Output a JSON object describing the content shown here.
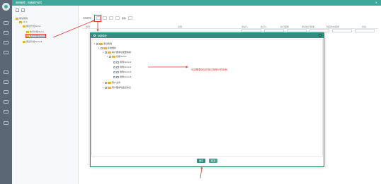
{
  "title": "用例管理 - 机器维护组件",
  "modal": {
    "title": "功能模块",
    "tree": [
      {
        "label": "测试用例",
        "level": 0
      },
      {
        "label": "系统维护",
        "level": 1
      },
      {
        "label": "客户要素功能要素库",
        "level": 2
      },
      {
        "label": "功能demo",
        "level": 3
      },
      {
        "label": "用例demo1",
        "level": 4
      },
      {
        "label": "用例demo2",
        "level": 4
      },
      {
        "label": "用例demo3",
        "level": 4
      },
      {
        "label": "用例demo4",
        "level": 4
      },
      {
        "label": "账户业务",
        "level": 2
      },
      {
        "label": "客户要求功能点信息",
        "level": 2
      }
    ],
    "annotation": "勾选需要添加的测试用例中的用例",
    "ok_label": "确定",
    "cancel_label": "取消"
  },
  "left_tree": [
    {
      "label": "测试用例"
    },
    {
      "label": "v1.0"
    },
    {
      "label": "测试计划demo"
    },
    {
      "label": "执行计划demo"
    },
    {
      "label": "执行计划demo2"
    },
    {
      "label": "测试计划demo2"
    }
  ],
  "main": {
    "toolbar_label": "功能模块",
    "btn_del": "删除",
    "columns": [
      "用例",
      "名称",
      "测试人",
      "执行人",
      "执行结果",
      "测试执行结果",
      "缺陷状态结果",
      "状态"
    ]
  },
  "accent_color": "#2f8f82",
  "highlight_color": "#e53935"
}
